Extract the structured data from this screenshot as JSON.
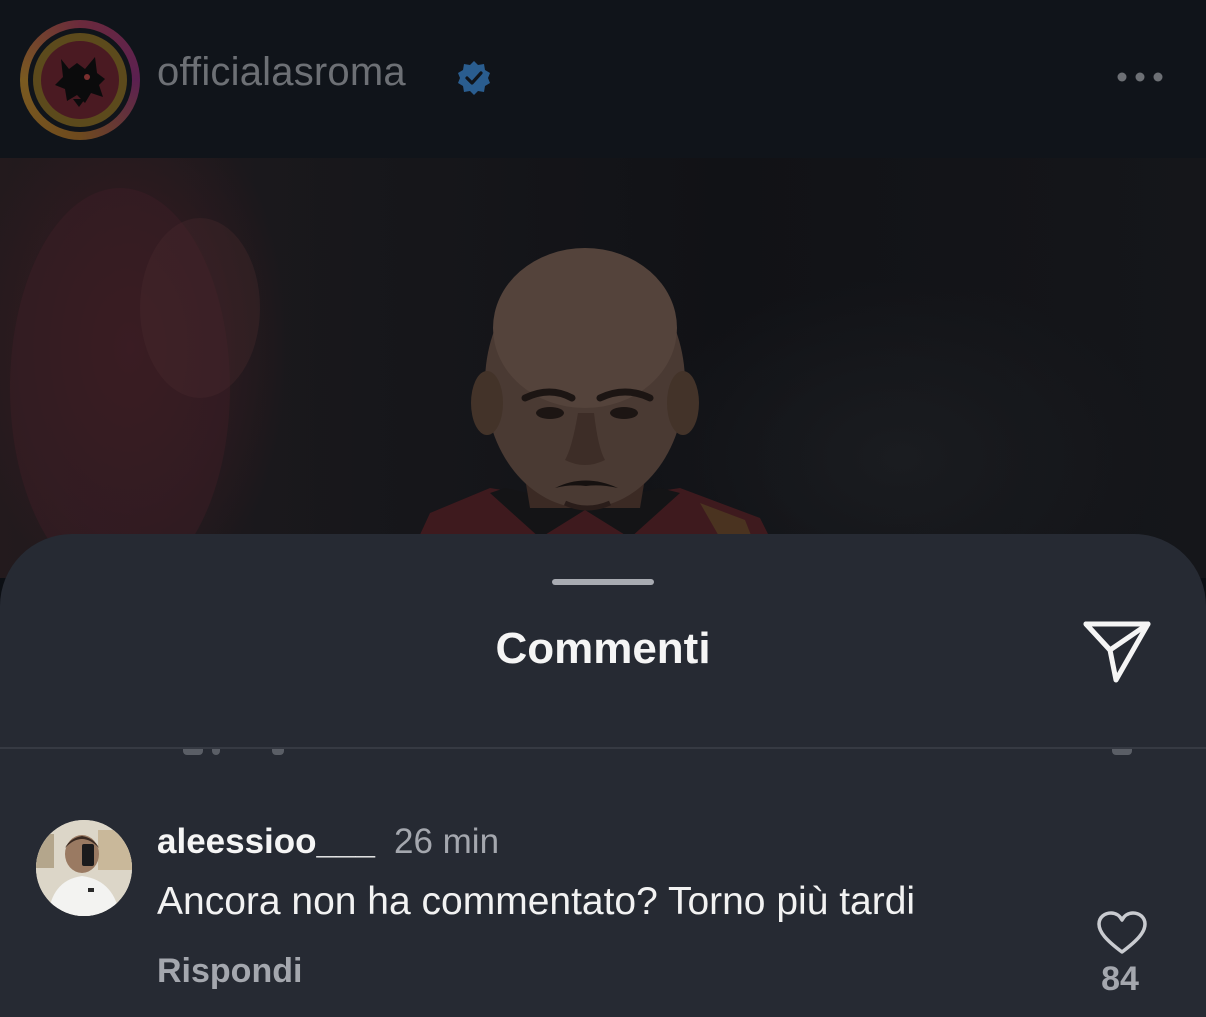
{
  "post_header": {
    "account_name": "officialasroma",
    "verified": true,
    "more_icon": "more-horizontal-icon"
  },
  "post_photo": {
    "description_icon": "photo"
  },
  "comments_sheet": {
    "title": "Commenti",
    "share_icon": "paper-plane-icon",
    "comments": [
      {
        "username": "aleessioo___",
        "time": "26 min",
        "text": "Ancora non ha commentato? Torno più tardi",
        "reply_label": "Rispondi",
        "like_count": "84",
        "like_icon": "heart-outline-icon"
      }
    ]
  },
  "colors": {
    "sheet_background": "#262a33",
    "header_background": "#10141a",
    "verified_blue": "#2a5d8f",
    "secondary_text": "#a4a7ae",
    "primary_text": "#f5f5f5"
  }
}
